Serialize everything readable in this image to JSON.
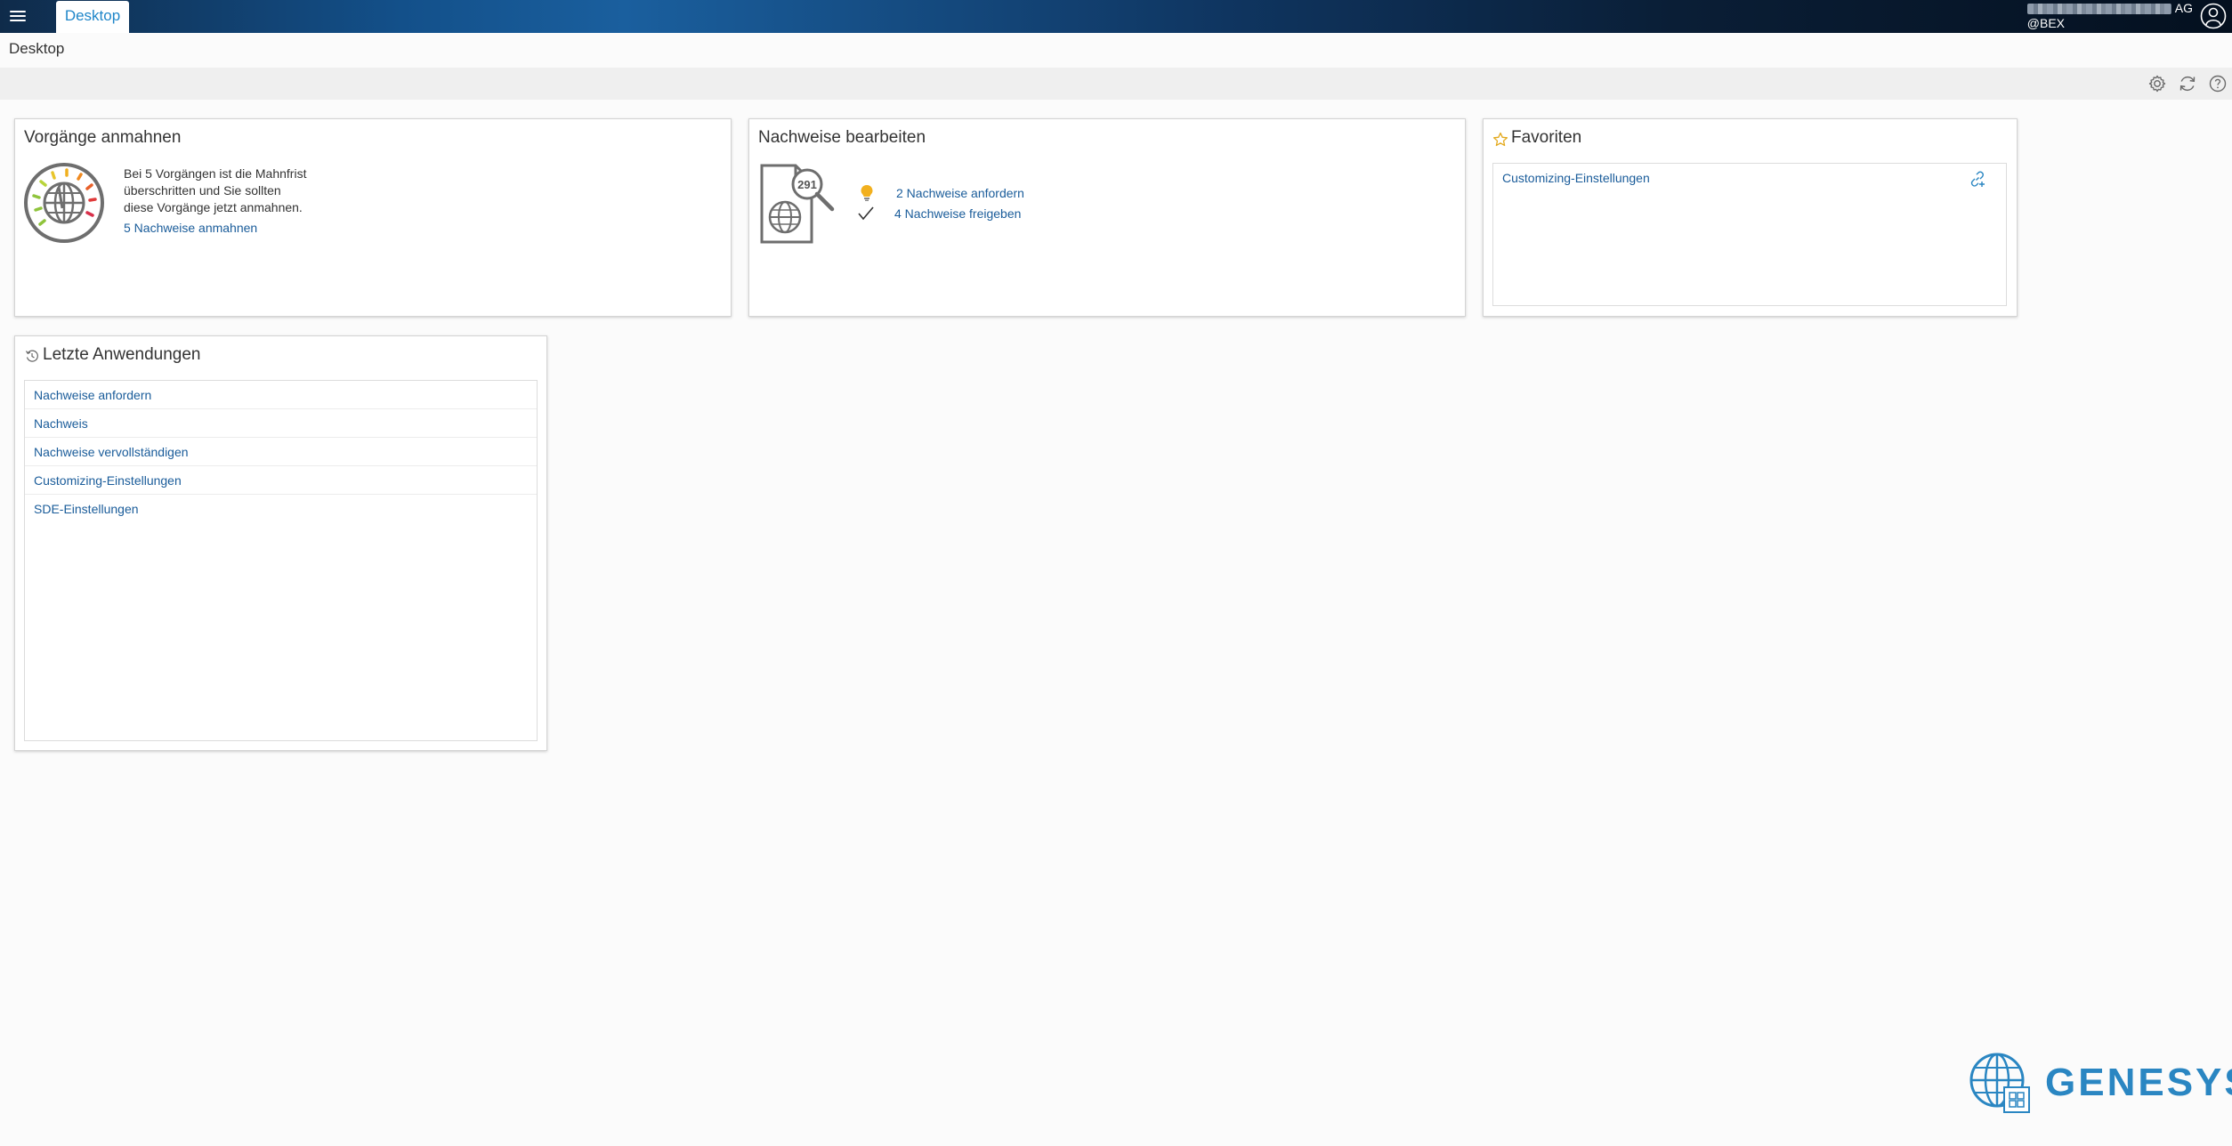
{
  "topbar": {
    "tab_label": "Desktop",
    "company_suffix": "AG",
    "user_line": "@BEX"
  },
  "breadcrumb": "Desktop",
  "panels": {
    "vorgaenge": {
      "title": "Vorgänge anmahnen",
      "text_lines": [
        "Bei 5 Vorgängen ist die Mahnfrist",
        "überschritten und Sie sollten",
        "diese Vorgänge jetzt anmahnen."
      ],
      "link": "5 Nachweise anmahnen"
    },
    "nachweise": {
      "title": "Nachweise bearbeiten",
      "badge": "291",
      "items": [
        {
          "icon": "lightbulb-icon",
          "label": "2 Nachweise anfordern"
        },
        {
          "icon": "checkmark-icon",
          "label": "4 Nachweise freigeben"
        }
      ]
    },
    "favoriten": {
      "title": "Favoriten",
      "items": [
        "Customizing-Einstellungen"
      ]
    },
    "letzte": {
      "title": "Letzte Anwendungen",
      "items": [
        "Nachweise anfordern",
        "Nachweis",
        "Nachweise vervollständigen",
        "Customizing-Einstellungen",
        "SDE-Einstellungen"
      ]
    }
  },
  "logo": {
    "text": "GENESYS"
  },
  "colors": {
    "accent": "#1f86c9",
    "link": "#1a5c9a",
    "bulb": "#f2b01e",
    "logo": "#2a86c2"
  }
}
